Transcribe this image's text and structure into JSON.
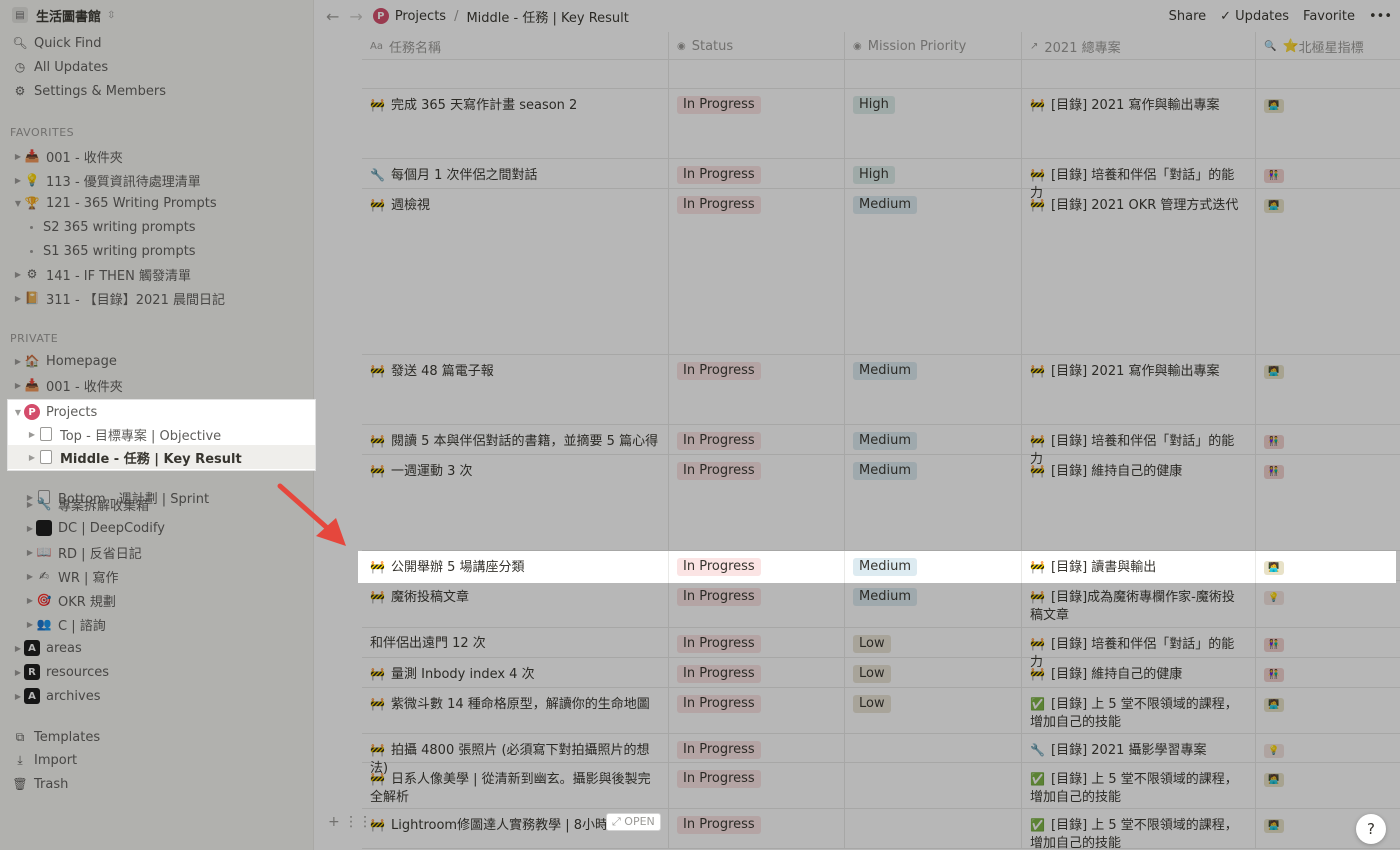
{
  "workspace": {
    "name": "生活圖書館"
  },
  "sidebar_top": [
    {
      "label": "Quick Find",
      "icon": "search-icon"
    },
    {
      "label": "All Updates",
      "icon": "clock-icon"
    },
    {
      "label": "Settings & Members",
      "icon": "gear-icon"
    }
  ],
  "favorites_label": "FAVORITES",
  "favorites": [
    {
      "label": "001 - 收件夾",
      "icon": "inbox-icon"
    },
    {
      "label": "113 - 優質資訊待處理清單",
      "icon": "bulb-icon"
    },
    {
      "label": "121 - 365 Writing Prompts",
      "icon": "trophy-icon"
    },
    {
      "label": "S2 365 writing prompts"
    },
    {
      "label": "S1 365 writing prompts"
    },
    {
      "label": "141 - IF THEN 觸發清單",
      "icon": "gear-icon"
    },
    {
      "label": "311 - 【目錄】2021 晨間日記",
      "icon": "book-icon"
    }
  ],
  "private_label": "PRIVATE",
  "private": [
    {
      "label": "Homepage",
      "icon": "house-icon"
    },
    {
      "label": "001 - 收件夾",
      "icon": "inbox-icon"
    },
    {
      "label": "Projects",
      "icon": "p-badge-icon",
      "badge": "P"
    },
    {
      "label": "Top - 目標專案 | Objective",
      "icon": "page-icon"
    },
    {
      "label": "Middle - 任務 | Key Result",
      "icon": "page-icon"
    },
    {
      "label": "Bottom - 週計劃 | Sprint",
      "icon": "page-icon"
    },
    {
      "label": "專案拆解收集箱",
      "icon": "wrench-icon"
    },
    {
      "label": "DC | DeepCodify",
      "icon": "black-square-icon"
    },
    {
      "label": "RD | 反省日記",
      "icon": "book-icon"
    },
    {
      "label": "WR | 寫作",
      "icon": "pen-icon"
    },
    {
      "label": "OKR 規劃",
      "icon": "target-icon"
    },
    {
      "label": "C | 諮詢",
      "icon": "people-icon"
    },
    {
      "label": "areas",
      "icon": "a-square-icon",
      "badge": "A"
    },
    {
      "label": "resources",
      "icon": "r-square-icon",
      "badge": "R"
    },
    {
      "label": "archives",
      "icon": "a-square-icon",
      "badge": "A"
    }
  ],
  "sidebar_bottom": [
    {
      "label": "Templates",
      "icon": "templates-icon"
    },
    {
      "label": "Import",
      "icon": "import-icon"
    },
    {
      "label": "Trash",
      "icon": "trash-icon"
    }
  ],
  "breadcrumb": {
    "root": "Projects",
    "root_badge": "P",
    "sep": "/",
    "current": "Middle - 任務 | Key Result"
  },
  "top_actions": {
    "share": "Share",
    "updates": "Updates",
    "favorite": "Favorite",
    "more": "•••"
  },
  "columns": [
    "任務名稱",
    "Status",
    "Mission Priority",
    "2021 總專案",
    "北極星指標"
  ],
  "column_icons": [
    "Aa",
    "◉",
    "◉",
    "↗",
    "🔍"
  ],
  "rows": [
    {
      "name": "",
      "status": "",
      "priority": "",
      "project": "",
      "star": ""
    },
    {
      "name": "完成 365 天寫作計畫 season 2",
      "status": "In Progress",
      "priority": "High",
      "project": "[目錄] 2021 寫作與輸出專案",
      "star": "🧑‍💻"
    },
    {
      "name": "每個月 1 次伴侶之間對話",
      "status": "In Progress",
      "priority": "High",
      "project": "[目錄] 培養和伴侶「對話」的能力",
      "star": "👫"
    },
    {
      "name": "週檢視",
      "status": "In Progress",
      "priority": "Medium",
      "project": "[目錄] 2021 OKR 管理方式迭代",
      "star": "🧑‍💻"
    },
    {
      "name": "發送 48 篇電子報",
      "status": "In Progress",
      "priority": "Medium",
      "project": "[目錄] 2021 寫作與輸出專案",
      "star": "🧑‍💻"
    },
    {
      "name": "閱讀 5 本與伴侶對話的書籍，並摘要 5 篇心得",
      "status": "In Progress",
      "priority": "Medium",
      "project": "[目錄] 培養和伴侶「對話」的能力",
      "star": "👫"
    },
    {
      "name": "一週運動 3 次",
      "status": "In Progress",
      "priority": "Medium",
      "project": "[目錄] 維持自己的健康",
      "star": "👫"
    },
    {
      "name": "公開舉辦 5 場講座分類",
      "status": "In Progress",
      "priority": "Medium",
      "project": "[目錄] 讀書與輸出",
      "star": "🧑‍💻"
    },
    {
      "name": "魔術投稿文章",
      "status": "In Progress",
      "priority": "Medium",
      "project": "[目錄]成為魔術專欄作家-魔術投稿文章",
      "star": "💡"
    },
    {
      "name": "和伴侶出遠門 12 次",
      "status": "In Progress",
      "priority": "Low",
      "project": "[目錄] 培養和伴侶「對話」的能力",
      "star": "👫"
    },
    {
      "name": "量測 Inbody index 4 次",
      "status": "In Progress",
      "priority": "Low",
      "project": "[目錄] 維持自己的健康",
      "star": "👫"
    },
    {
      "name": "紫微斗數 14 種命格原型，解讀你的生命地圖",
      "status": "In Progress",
      "priority": "Low",
      "project": "[目錄] 上 5 堂不限領域的課程，增加自己的技能",
      "star": "🧑‍💻"
    },
    {
      "name": "拍攝 4800 張照片 (必須寫下對拍攝照片的想法)",
      "status": "In Progress",
      "priority": "",
      "project": "[目錄] 2021 攝影學習專案",
      "star": "💡"
    },
    {
      "name": "日系人像美學 | 從清新到幽玄。攝影與後製完全解析",
      "status": "In Progress",
      "priority": "",
      "project": "[目錄] 上 5 堂不限領域的課程，增加自己的技能",
      "star": "🧑‍💻"
    },
    {
      "name": "Lightroom修圖達人實務教學 | 8小時入",
      "status": "In Progress",
      "priority": "",
      "project": "[目錄] 上 5 堂不限領域的課程，增加自己的技能",
      "star": "🧑‍💻"
    }
  ],
  "open_label": "OPEN",
  "help_label": "?"
}
